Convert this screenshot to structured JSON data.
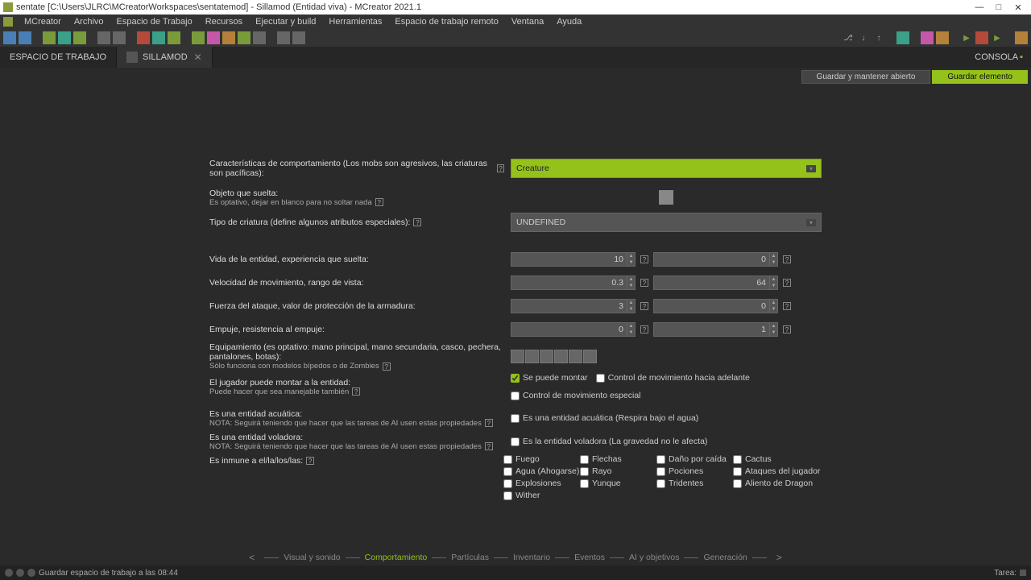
{
  "window": {
    "title": "sentate [C:\\Users\\JLRC\\MCreatorWorkspaces\\sentatemod] - Sillamod (Entidad viva) - MCreator 2021.1",
    "console": "CONSOLA"
  },
  "menu": {
    "mcreator": "MCreator",
    "archivo": "Archivo",
    "espacio": "Espacio de Trabajo",
    "recursos": "Recursos",
    "ejecutar": "Ejecutar y build",
    "herramientas": "Herramientas",
    "remoto": "Espacio de trabajo remoto",
    "ventana": "Ventana",
    "ayuda": "Ayuda"
  },
  "tabs": {
    "workspace": "ESPACIO DE TRABAJO",
    "sillamod": "SILLAMOD"
  },
  "actions": {
    "keep_open": "Guardar y mantener abierto",
    "save": "Guardar elemento"
  },
  "labels": {
    "behavior": "Características de comportamiento (Los mobs son agresivos, las criaturas son pacíficas):",
    "drop": "Objeto que suelta:",
    "drop_sub": "Es optativo, dejar en blanco para no soltar nada",
    "creature_type": "Tipo de criatura (define algunos atributos especiales):",
    "health": "Vida de la entidad, experiencia que suelta:",
    "speed": "Velocidad de movimiento, rango de vista:",
    "attack": "Fuerza del ataque, valor de protección de la armadura:",
    "knockback": "Empuje, resistencia al empuje:",
    "equipment": "Equipamiento (es optativo: mano principal, mano secundaria, casco, pechera, pantalones, botas):",
    "equipment_sub": "Sólo funciona con modelos bípedos o de Zombies",
    "rideable": "El jugador puede montar a la entidad:",
    "rideable_sub": "Puede hacer que sea manejable también",
    "water": "Es una entidad acuática:",
    "water_sub": "NOTA: Seguirá teniendo que hacer que las tareas de AI usen estas propiedades",
    "flying": "Es una entidad voladora:",
    "flying_sub": "NOTA: Seguirá teniendo que hacer que las tareas de AI usen estas propiedades",
    "immune": "Es inmune a el/la/los/las:"
  },
  "values": {
    "behavior": "Creature",
    "creature_type": "UNDEFINED",
    "health": "10",
    "xp": "0",
    "speed": "0.3",
    "view": "64",
    "attack": "3",
    "armor": "0",
    "knockback": "0",
    "kb_resist": "1"
  },
  "checkboxes": {
    "rideable": "Se puede montar",
    "forward_control": "Control de movimiento hacia adelante",
    "special_control": "Control de movimiento especial",
    "water_entity": "Es una entidad acuática (Respira bajo el agua)",
    "flying_entity": "Es la entidad voladora (La gravedad no le afecta)"
  },
  "immune": {
    "fuego": "Fuego",
    "flechas": "Flechas",
    "caida": "Daño por caída",
    "cactus": "Cactus",
    "agua": "Agua (Ahogarse)",
    "rayo": "Rayo",
    "pociones": "Pociones",
    "jugador": "Ataques del jugador",
    "explosiones": "Explosiones",
    "yunque": "Yunque",
    "tridentes": "Tridentes",
    "dragon": "Aliento de Dragon",
    "wither": "Wither"
  },
  "wizard": {
    "visual": "Visual y sonido",
    "comportamiento": "Comportamiento",
    "particulas": "Partículas",
    "inventario": "Inventario",
    "eventos": "Eventos",
    "ai": "AI y objetivos",
    "generacion": "Generación"
  },
  "status": {
    "save_msg": "Guardar espacio de trabajo a las 08:44",
    "tarea": "Tarea:"
  }
}
